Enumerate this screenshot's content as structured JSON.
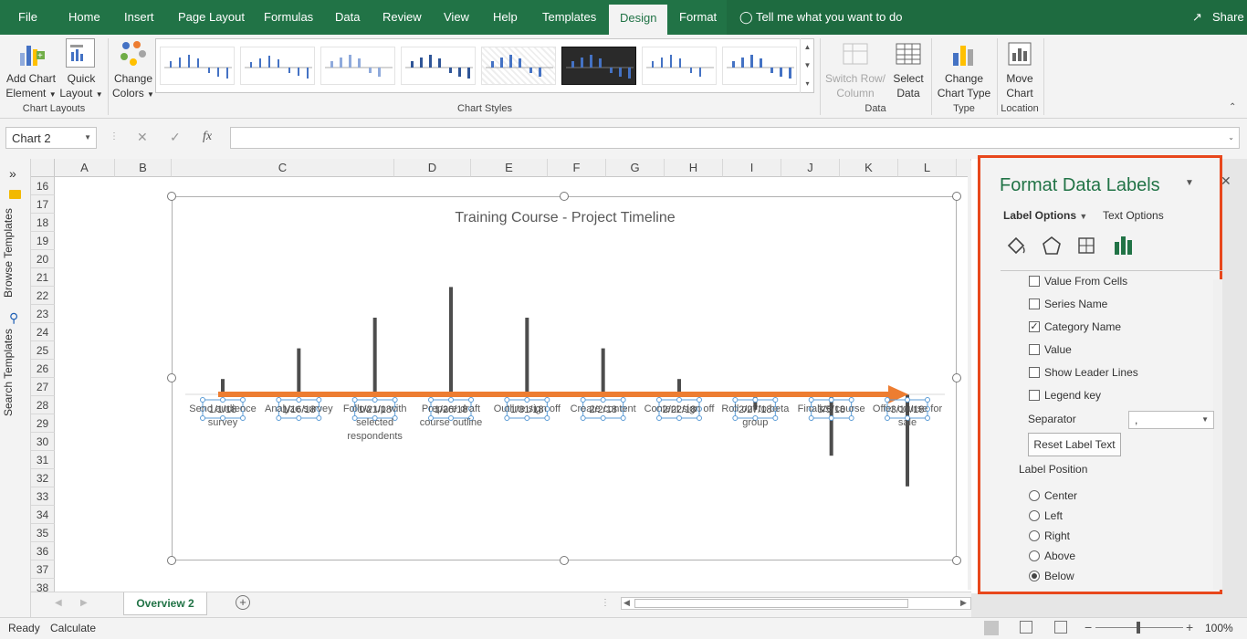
{
  "tabs": [
    "File",
    "Home",
    "Insert",
    "Page Layout",
    "Formulas",
    "Data",
    "Review",
    "View",
    "Help",
    "Templates",
    "Design",
    "Format"
  ],
  "tell_me": "Tell me what you want to do",
  "share": "Share",
  "ribbon": {
    "add_chart_element": [
      "Add Chart",
      "Element"
    ],
    "quick_layout": [
      "Quick",
      "Layout"
    ],
    "change_colors": [
      "Change",
      "Colors"
    ],
    "switch_row_column": [
      "Switch Row/",
      "Column"
    ],
    "select_data": [
      "Select",
      "Data"
    ],
    "change_chart_type": [
      "Change",
      "Chart Type"
    ],
    "move_chart": [
      "Move",
      "Chart"
    ],
    "groups": {
      "chart_layouts": "Chart Layouts",
      "chart_styles": "Chart Styles",
      "data": "Data",
      "type": "Type",
      "location": "Location"
    }
  },
  "name_box": "Chart 2",
  "fx": "fx",
  "side_panel": {
    "browse": "Browse Templates",
    "search": "Search Templates"
  },
  "columns": [
    "A",
    "B",
    "C",
    "D",
    "E",
    "F",
    "G",
    "H",
    "I",
    "J",
    "K",
    "L"
  ],
  "rows": [
    "16",
    "17",
    "18",
    "19",
    "20",
    "21",
    "22",
    "23",
    "24",
    "25",
    "26",
    "27",
    "28",
    "29",
    "30",
    "31",
    "32",
    "33",
    "34",
    "35",
    "36",
    "37",
    "38"
  ],
  "chart_data": {
    "type": "bar",
    "title": "Training Course - Project Timeline",
    "categories": [
      "Send audience survey",
      "Analyze survey",
      "Follow up with selected respondents",
      "Prepare draft course outline",
      "Outline sign off",
      "Create content",
      "Content sign off",
      "Roll out to beta group",
      "Finalize course",
      "Offer course for sale"
    ],
    "dates": [
      "1/1/18",
      "1/16/18",
      "1/21/18",
      "1/26/18",
      "1/31/18",
      "2/2/18",
      "2/22/18",
      "2/27/18",
      "3/5/18",
      "3/10/18"
    ],
    "values": [
      1,
      3,
      5,
      7,
      5,
      3,
      1,
      -1,
      -4,
      -6
    ],
    "ylim": [
      -7,
      8
    ]
  },
  "sheet_tab": "Overview 2",
  "pane": {
    "title": "Format Data Labels",
    "tab_label_options": "Label Options",
    "tab_text_options": "Text Options",
    "checkboxes": [
      {
        "label": "Value From Cells",
        "checked": false
      },
      {
        "label": "Series Name",
        "checked": false
      },
      {
        "label": "Category Name",
        "checked": true
      },
      {
        "label": "Value",
        "checked": false
      },
      {
        "label": "Show Leader Lines",
        "checked": false
      },
      {
        "label": "Legend key",
        "checked": false
      }
    ],
    "separator_label": "Separator",
    "separator_value": ",",
    "reset_button": "Reset Label Text",
    "label_position": "Label Position",
    "radios": [
      {
        "label": "Center",
        "selected": false
      },
      {
        "label": "Left",
        "selected": false
      },
      {
        "label": "Right",
        "selected": false
      },
      {
        "label": "Above",
        "selected": false
      },
      {
        "label": "Below",
        "selected": true
      }
    ]
  },
  "status": {
    "ready": "Ready",
    "calculate": "Calculate",
    "zoom": "100%"
  },
  "colors": {
    "excel_green": "#217346",
    "accent_orange": "#e8471c",
    "arrow_orange": "#ed7d31",
    "bar_gray": "#4d4d4d"
  }
}
